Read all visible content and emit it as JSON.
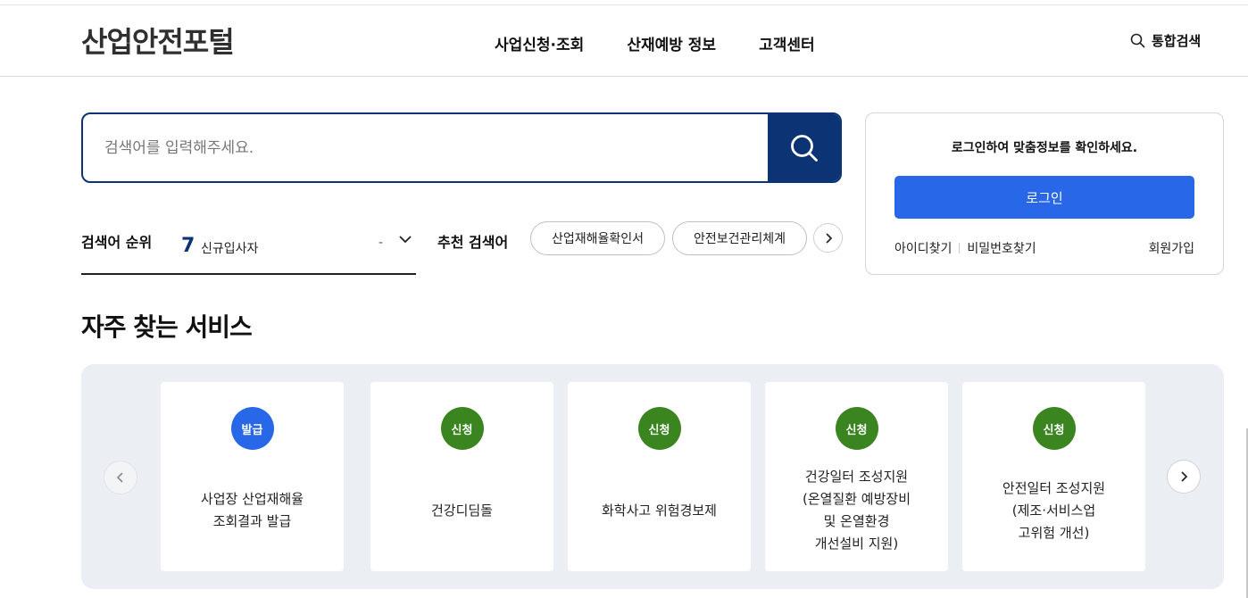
{
  "header": {
    "logo": "산업안전포털",
    "nav": [
      "사업신청·조회",
      "산재예방 정보",
      "고객센터"
    ],
    "search_label": "통합검색"
  },
  "search": {
    "placeholder": "검색어를 입력해주세요."
  },
  "ranking": {
    "label": "검색어 순위",
    "rank": "7",
    "keyword": "신규입사자",
    "change": "-"
  },
  "recommend": {
    "label": "추천 검색어",
    "chips": [
      "산업재해율확인서",
      "안전보건관리체계"
    ]
  },
  "login": {
    "message": "로그인하여 맞춤정보를 확인하세요.",
    "button": "로그인",
    "find_id": "아이디찾기",
    "find_pw": "비밀번호찾기",
    "join": "회원가입"
  },
  "services": {
    "title": "자주 찾는 서비스",
    "cards": [
      {
        "badge": "발급",
        "text": "사업장 산업재해율\n조회결과 발급"
      },
      {
        "badge": "신청",
        "text": "건강디딤돌"
      },
      {
        "badge": "신청",
        "text": "화학사고 위험경보제"
      },
      {
        "badge": "신청",
        "text": "건강일터 조성지원\n(온열질환 예방장비\n및 온열환경\n개선설비 지원)"
      },
      {
        "badge": "신청",
        "text": "안전일터 조성지원\n(제조·서비스업\n고위험 개선)"
      }
    ]
  },
  "colors": {
    "brand_navy": "#0c3474",
    "login_blue": "#2868e8",
    "badge_blue": "#2868e8",
    "badge_green": "#3a8520"
  }
}
